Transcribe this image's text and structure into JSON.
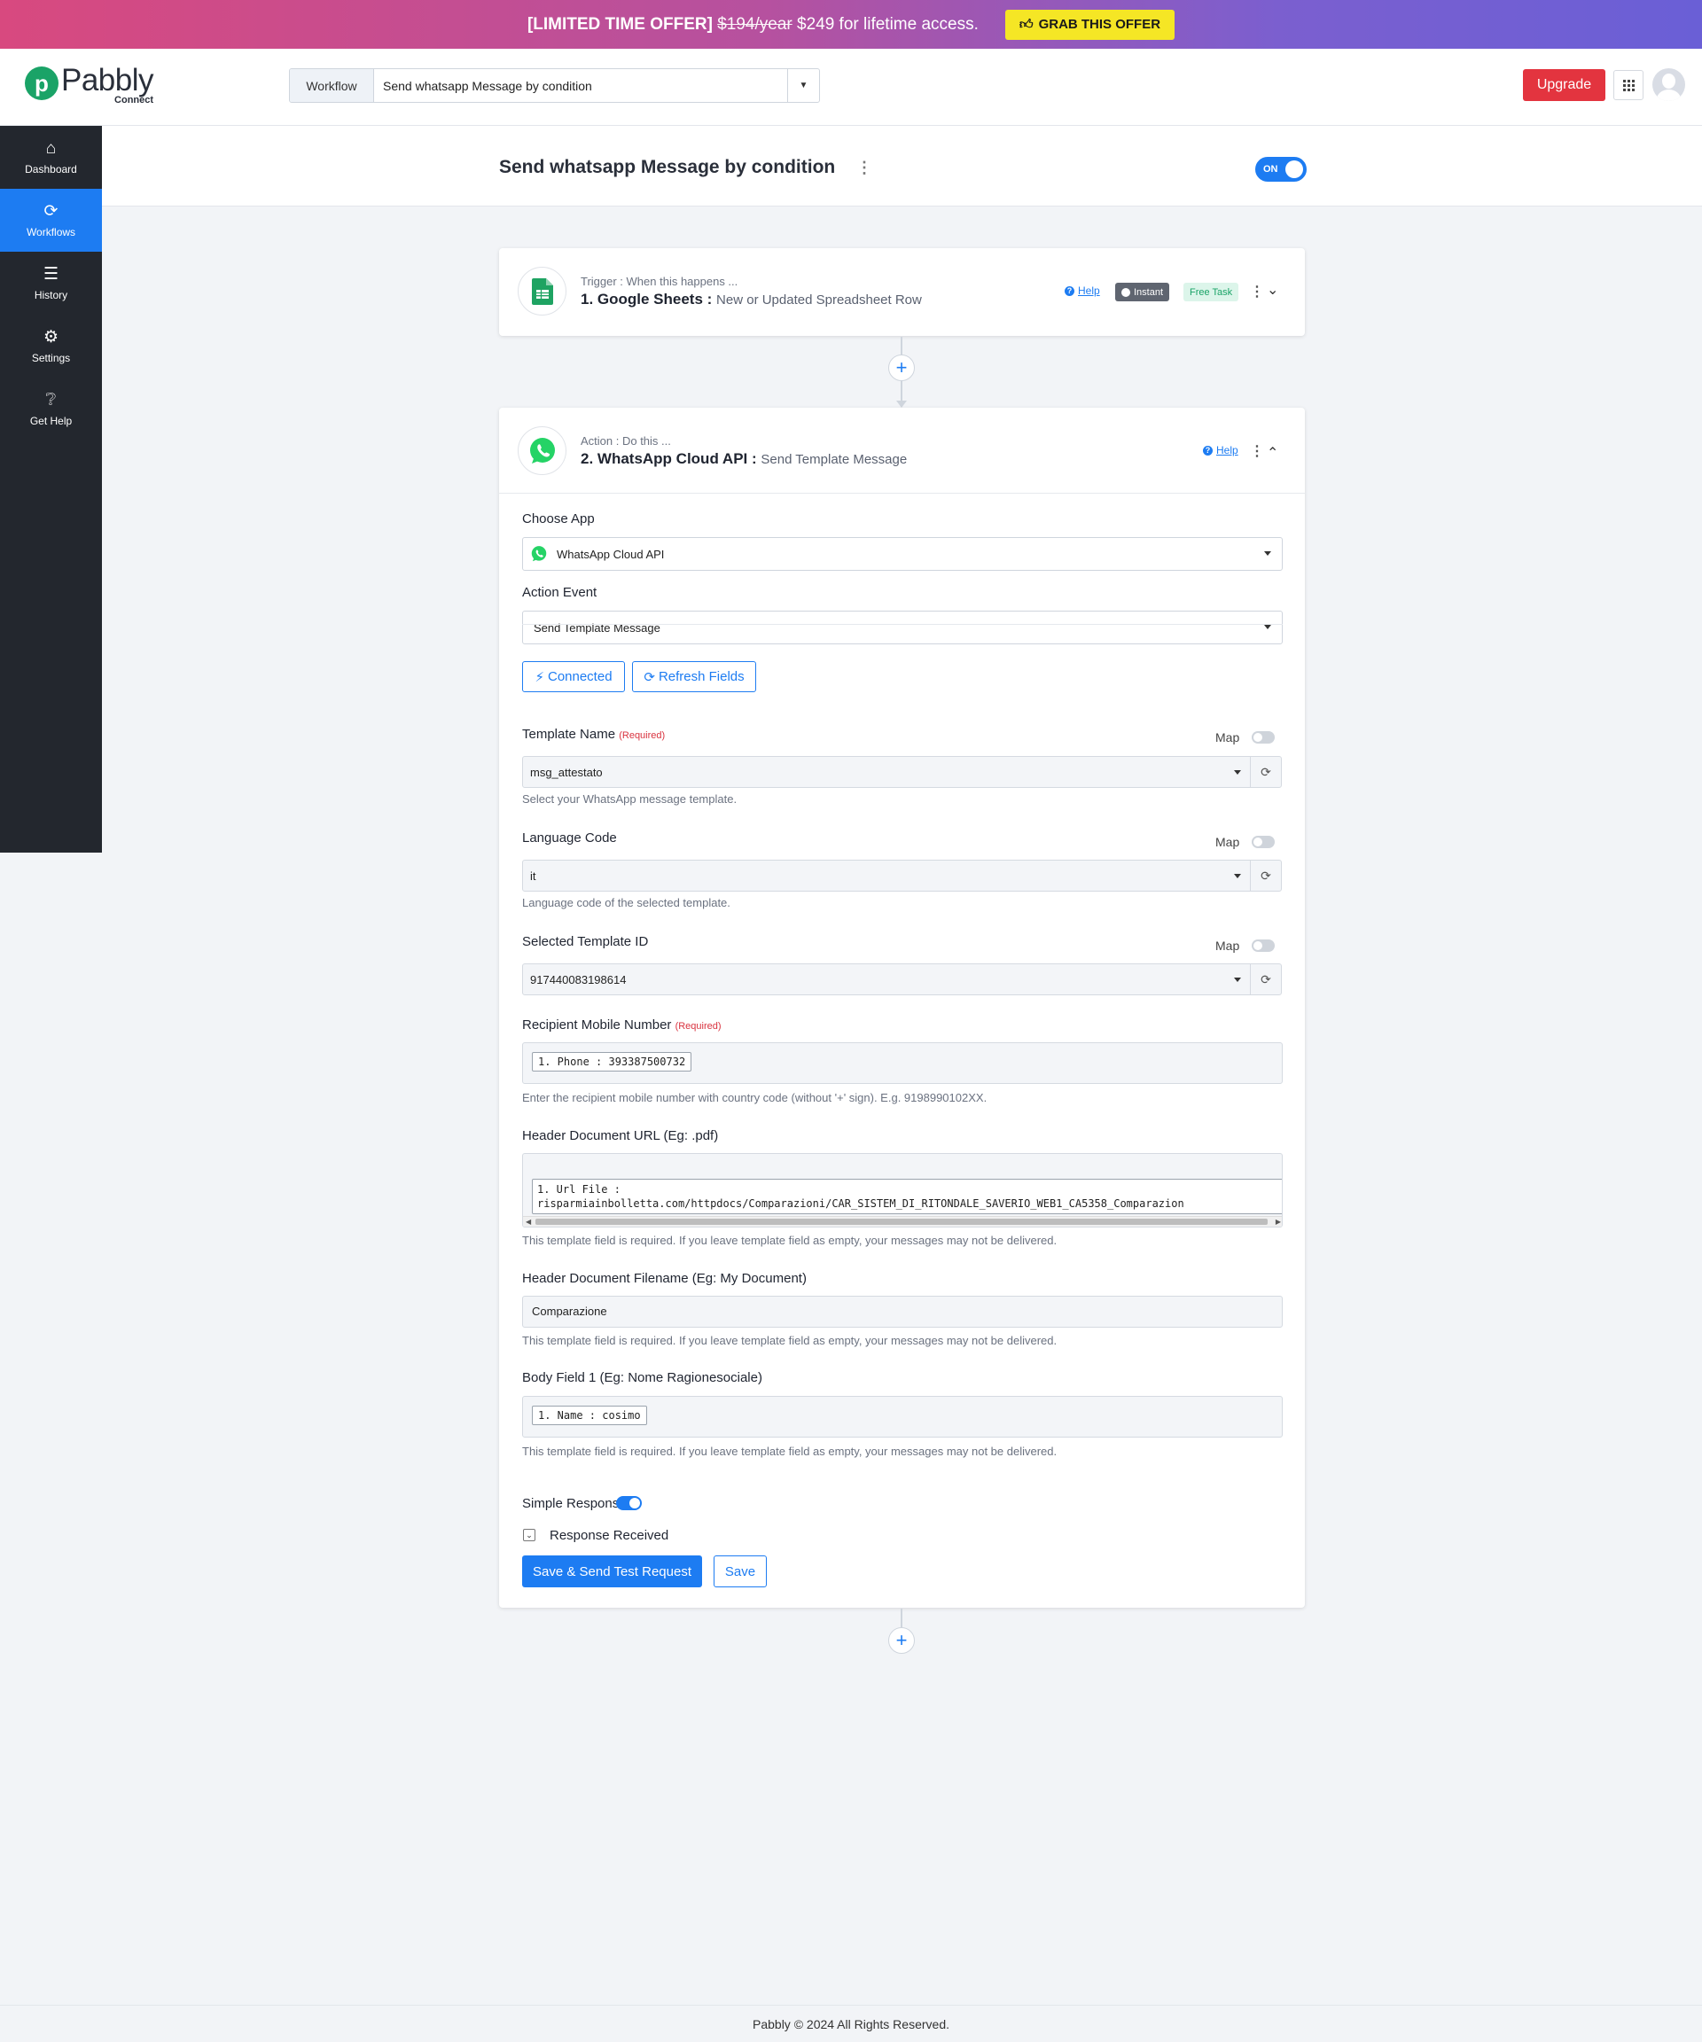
{
  "promo": {
    "offer_label": "[LIMITED TIME OFFER]",
    "old_price": "$194/year",
    "new_price": "$249 for lifetime access.",
    "cta": "GRAB THIS OFFER",
    "cta_icon": "thumbs-up-icon",
    "colors": {
      "gradient_start": "#d8497f",
      "gradient_end": "#6a5fd6",
      "cta_bg": "#f5e625"
    }
  },
  "header": {
    "logo_text": "Pabbly",
    "logo_sub": "Connect",
    "workflow_label": "Workflow",
    "workflow_selected": "Send whatsapp Message by condition",
    "upgrade_label": "Upgrade",
    "accent": "#1d7cf2",
    "upgrade_color": "#e3343f"
  },
  "sidebar": {
    "items": [
      {
        "label": "Dashboard",
        "icon": "home-icon",
        "active": false
      },
      {
        "label": "Workflows",
        "icon": "workflow-icon",
        "active": true
      },
      {
        "label": "History",
        "icon": "history-list-icon",
        "active": false
      },
      {
        "label": "Settings",
        "icon": "gear-icon",
        "active": false
      },
      {
        "label": "Get Help",
        "icon": "question-icon",
        "active": false
      }
    ]
  },
  "workflow": {
    "title": "Send whatsapp Message by condition",
    "status_label": "ON"
  },
  "trigger": {
    "kind": "Trigger : When this happens ...",
    "app": "1. Google Sheets :",
    "event": "New or Updated Spreadsheet Row",
    "help": "Help",
    "badge_instant": "Instant",
    "badge_free": "Free Task"
  },
  "action": {
    "kind": "Action : Do this ...",
    "app": "2. WhatsApp Cloud API :",
    "event": "Send Template Message",
    "help": "Help",
    "choose_app_label": "Choose App",
    "choose_app_value": "WhatsApp Cloud API",
    "action_event_label": "Action Event",
    "action_event_value": "Send Template Message",
    "connected_label": "Connected",
    "refresh_label": "Refresh Fields",
    "map_label": "Map",
    "required": "(Required)",
    "fields": {
      "template_name": {
        "label": "Template Name",
        "value": "msg_attestato",
        "hint": "Select your WhatsApp message template."
      },
      "language_code": {
        "label": "Language Code",
        "value": "it",
        "hint": "Language code of the selected template."
      },
      "template_id": {
        "label": "Selected Template ID",
        "value": "917440083198614"
      },
      "recipient": {
        "label": "Recipient Mobile Number",
        "chip": "1. Phone : 393387500732",
        "hint": "Enter the recipient mobile number with country code (without '+' sign). E.g. 9198990102XX."
      },
      "doc_url": {
        "label": "Header Document URL (Eg: .pdf)",
        "chip_line1": "1. Url File :",
        "chip_line2": "risparmiainbolletta.com/httpdocs/Comparazioni/CAR_SISTEM_DI_RITONDALE_SAVERIO_WEB1_CA5358_Comparazion",
        "hint": "This template field is required. If you leave template field as empty, your messages may not be delivered."
      },
      "doc_filename": {
        "label": "Header Document Filename (Eg: My Document)",
        "value": "Comparazione",
        "hint": "This template field is required. If you leave template field as empty, your messages may not be delivered."
      },
      "body_field": {
        "label": "Body Field 1 (Eg: Nome Ragionesociale)",
        "chip": "1. Name : cosimo",
        "hint": "This template field is required. If you leave template field as empty, your messages may not be delivered."
      }
    },
    "simple_response_label": "Simple Response",
    "response_received_label": "Response Received",
    "save_test_label": "Save & Send Test Request",
    "save_label": "Save"
  },
  "footer": {
    "text": "Pabbly © 2024 All Rights Reserved."
  }
}
